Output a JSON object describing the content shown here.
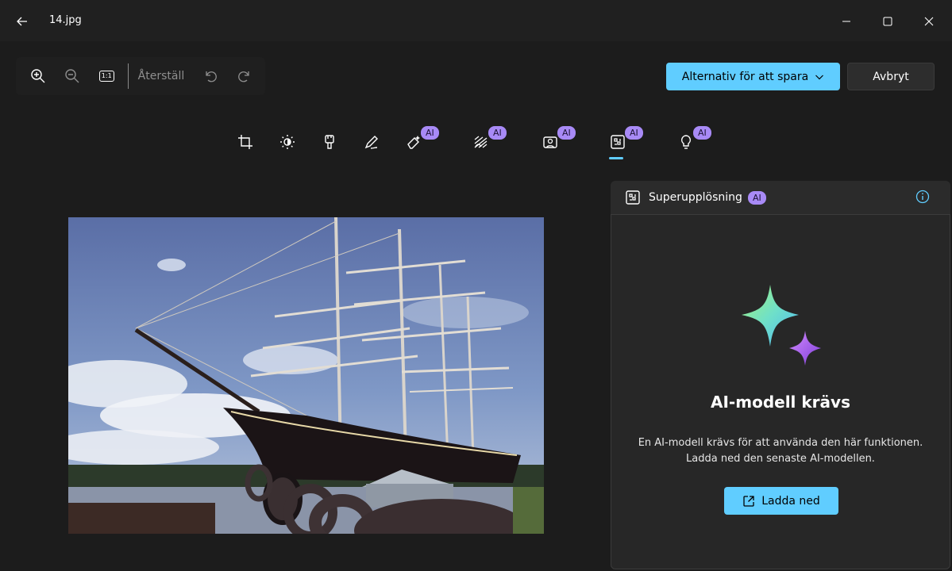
{
  "window": {
    "title": "14.jpg",
    "controls": [
      "back-icon",
      "minimize-icon",
      "maximize-icon",
      "close-icon"
    ]
  },
  "toolbar": {
    "zoom_in_icon": "zoom-in-icon",
    "zoom_out_icon": "zoom-out-icon",
    "actual_size_label": "1:1",
    "reset_label": "Återställ",
    "undo_icon": "undo-icon",
    "redo_icon": "redo-icon",
    "save_label": "Alternativ för att spara",
    "cancel_label": "Avbryt"
  },
  "edit_tools": [
    {
      "name": "crop",
      "icon": "crop-icon",
      "ai": false
    },
    {
      "name": "adjust",
      "icon": "brightness-icon",
      "ai": false
    },
    {
      "name": "filter",
      "icon": "brush-icon",
      "ai": false
    },
    {
      "name": "markup",
      "icon": "pen-icon",
      "ai": false
    },
    {
      "name": "erase",
      "icon": "eraser-icon",
      "ai": true,
      "badge": "AI"
    },
    {
      "name": "background-blur",
      "icon": "blur-icon",
      "ai": true,
      "badge": "AI"
    },
    {
      "name": "background",
      "icon": "portrait-icon",
      "ai": true,
      "badge": "AI"
    },
    {
      "name": "super-resolution",
      "icon": "super-resolution-icon",
      "ai": true,
      "badge": "AI",
      "selected": true
    },
    {
      "name": "lightbulb",
      "icon": "lightbulb-icon",
      "ai": true,
      "badge": "AI"
    }
  ],
  "panel": {
    "title": "Superupplösning",
    "badge": "AI",
    "heading": "AI-modell krävs",
    "text_line1": "En AI-modell krävs för att använda den här funktionen.",
    "text_line2": "Ladda ned den senaste AI-modellen.",
    "download_label": "Ladda ned"
  },
  "colors": {
    "accent": "#60cdff",
    "ai_badge": "#a88af6",
    "background": "#1c1c1c"
  }
}
